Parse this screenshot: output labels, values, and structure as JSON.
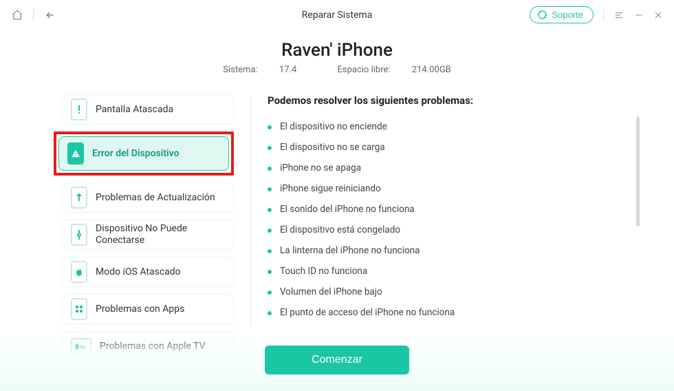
{
  "titlebar": {
    "title": "Reparar Sistema",
    "support_label": "Soporte"
  },
  "header": {
    "device_name": "Raven' iPhone",
    "system_label": "Sistema:",
    "system_value": "17.4",
    "free_label": "Espacio libre:",
    "free_value": "214.00GB"
  },
  "left": {
    "items": [
      {
        "label": "Pantalla Atascada"
      },
      {
        "label": "Error del Dispositivo"
      },
      {
        "label": "Problemas de Actualización"
      },
      {
        "label": "Dispositivo No Puede Conectarse"
      },
      {
        "label": "Modo iOS Atascado"
      },
      {
        "label": "Problemas con Apps"
      },
      {
        "label": "Problemas con Apple TV"
      }
    ],
    "selected_index": 1
  },
  "right": {
    "title": "Podemos resolver los siguientes problemas:",
    "bullets": [
      "El dispositivo no enciende",
      "El dispositivo no se carga",
      "iPhone no se apaga",
      "iPhone sigue reiniciando",
      "El sonido del iPhone no funciona",
      "El dispositivo está congelado",
      "La linterna del iPhone no funciona",
      "Touch ID no funciona",
      "Volumen del iPhone bajo",
      "El punto de acceso del iPhone no funciona"
    ]
  },
  "footer": {
    "start_label": "Comenzar"
  },
  "colors": {
    "accent": "#1bc6a3",
    "highlight_border": "#e81b1b"
  }
}
